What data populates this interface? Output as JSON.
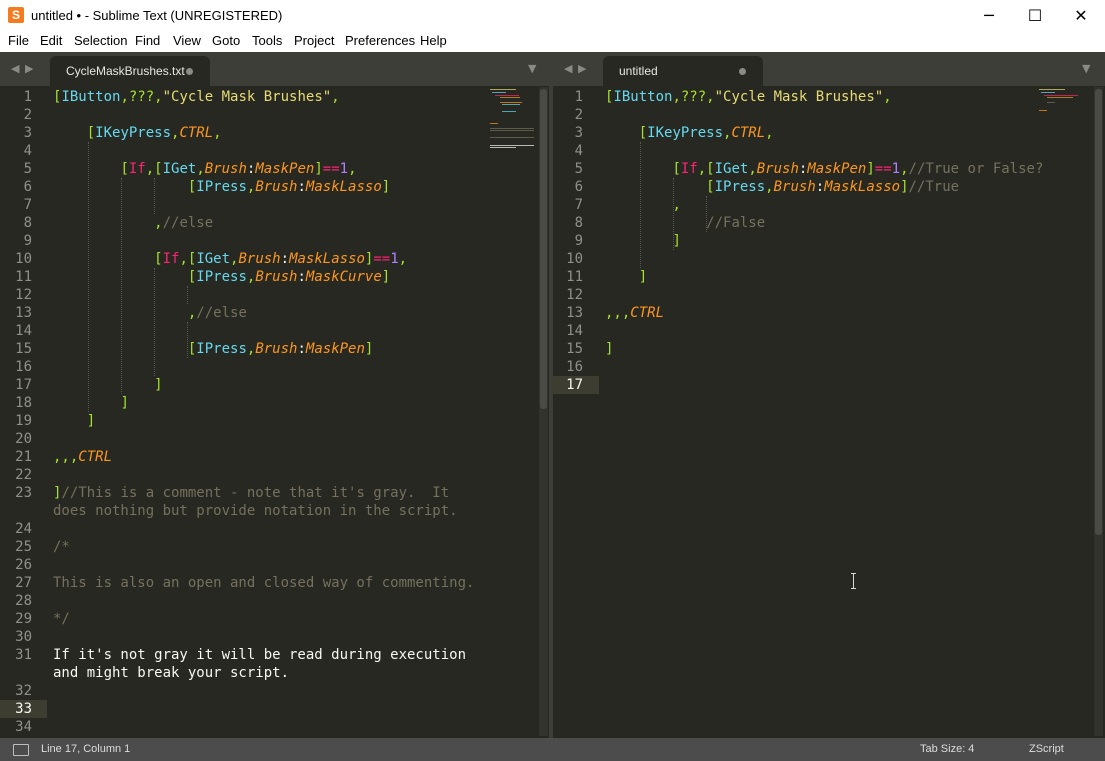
{
  "window": {
    "title": "untitled • - Sublime Text (UNREGISTERED)",
    "minimize_glyph": "─",
    "maximize_glyph": "☐",
    "close_glyph": "✕",
    "app_icon_glyph": "S"
  },
  "menu": [
    "File",
    "Edit",
    "Selection",
    "Find",
    "View",
    "Goto",
    "Tools",
    "Project",
    "Preferences",
    "Help"
  ],
  "colors": {
    "bracket": "#a6e22e",
    "command": "#66d9ef",
    "keyword": "#f92672",
    "param": "#fd971f",
    "string": "#e6db74",
    "number": "#ae81ff",
    "comment": "#75715e",
    "plain": "#f8f8f2"
  },
  "left_pane": {
    "tab_label": "CycleMaskBrushes.txt",
    "current_line": 33,
    "lines": [
      {
        "n": "1",
        "tokens": [
          [
            "[",
            "bracket"
          ],
          [
            "IButton",
            "command"
          ],
          [
            ",???,",
            "bracket"
          ],
          [
            "\"Cycle Mask Brushes\"",
            "string"
          ],
          [
            ",",
            "bracket"
          ]
        ]
      },
      {
        "n": "2",
        "tokens": []
      },
      {
        "n": "3",
        "tokens": [
          [
            "    ",
            ""
          ],
          [
            "[",
            "bracket"
          ],
          [
            "IKeyPress",
            "command"
          ],
          [
            ",",
            "bracket"
          ],
          [
            "CTRL",
            "param"
          ],
          [
            ",",
            "bracket"
          ]
        ]
      },
      {
        "n": "4",
        "tokens": []
      },
      {
        "n": "5",
        "tokens": [
          [
            "        ",
            ""
          ],
          [
            "[",
            "bracket"
          ],
          [
            "If",
            "keyword"
          ],
          [
            ",[",
            "bracket"
          ],
          [
            "IGet",
            "command"
          ],
          [
            ",",
            "bracket"
          ],
          [
            "Brush",
            "param"
          ],
          [
            ":",
            "plain"
          ],
          [
            "MaskPen",
            "param"
          ],
          [
            "]",
            "bracket"
          ],
          [
            "==",
            "keyword"
          ],
          [
            "1",
            "number"
          ],
          [
            ",",
            "bracket"
          ]
        ]
      },
      {
        "n": "6",
        "tokens": [
          [
            "                ",
            ""
          ],
          [
            "[",
            "bracket"
          ],
          [
            "IPress",
            "command"
          ],
          [
            ",",
            "bracket"
          ],
          [
            "Brush",
            "param"
          ],
          [
            ":",
            "plain"
          ],
          [
            "MaskLasso",
            "param"
          ],
          [
            "]",
            "bracket"
          ]
        ]
      },
      {
        "n": "7",
        "tokens": []
      },
      {
        "n": "8",
        "tokens": [
          [
            "            ",
            ""
          ],
          [
            ",",
            "bracket"
          ],
          [
            "//else",
            "comment"
          ]
        ]
      },
      {
        "n": "9",
        "tokens": []
      },
      {
        "n": "10",
        "tokens": [
          [
            "            ",
            ""
          ],
          [
            "[",
            "bracket"
          ],
          [
            "If",
            "keyword"
          ],
          [
            ",[",
            "bracket"
          ],
          [
            "IGet",
            "command"
          ],
          [
            ",",
            "bracket"
          ],
          [
            "Brush",
            "param"
          ],
          [
            ":",
            "plain"
          ],
          [
            "MaskLasso",
            "param"
          ],
          [
            "]",
            "bracket"
          ],
          [
            "==",
            "keyword"
          ],
          [
            "1",
            "number"
          ],
          [
            ",",
            "bracket"
          ]
        ]
      },
      {
        "n": "11",
        "tokens": [
          [
            "                ",
            ""
          ],
          [
            "[",
            "bracket"
          ],
          [
            "IPress",
            "command"
          ],
          [
            ",",
            "bracket"
          ],
          [
            "Brush",
            "param"
          ],
          [
            ":",
            "plain"
          ],
          [
            "MaskCurve",
            "param"
          ],
          [
            "]",
            "bracket"
          ]
        ]
      },
      {
        "n": "12",
        "tokens": []
      },
      {
        "n": "13",
        "tokens": [
          [
            "                ",
            ""
          ],
          [
            ",",
            "bracket"
          ],
          [
            "//else",
            "comment"
          ]
        ]
      },
      {
        "n": "14",
        "tokens": []
      },
      {
        "n": "15",
        "tokens": [
          [
            "                ",
            ""
          ],
          [
            "[",
            "bracket"
          ],
          [
            "IPress",
            "command"
          ],
          [
            ",",
            "bracket"
          ],
          [
            "Brush",
            "param"
          ],
          [
            ":",
            "plain"
          ],
          [
            "MaskPen",
            "param"
          ],
          [
            "]",
            "bracket"
          ]
        ]
      },
      {
        "n": "16",
        "tokens": []
      },
      {
        "n": "17",
        "tokens": [
          [
            "            ",
            ""
          ],
          [
            "]",
            "bracket"
          ]
        ]
      },
      {
        "n": "18",
        "tokens": [
          [
            "        ",
            ""
          ],
          [
            "]",
            "bracket"
          ]
        ]
      },
      {
        "n": "19",
        "tokens": [
          [
            "    ",
            ""
          ],
          [
            "]",
            "bracket"
          ]
        ]
      },
      {
        "n": "20",
        "tokens": []
      },
      {
        "n": "21",
        "tokens": [
          [
            ",,,",
            "bracket"
          ],
          [
            "CTRL",
            "param"
          ]
        ]
      },
      {
        "n": "22",
        "tokens": []
      },
      {
        "n": "23",
        "tokens": [
          [
            "]",
            "bracket"
          ],
          [
            "//This is a comment - note that it's gray.  It",
            "comment"
          ]
        ]
      },
      {
        "n": "",
        "tokens": [
          [
            "does nothing but provide notation in the script.",
            "comment"
          ]
        ]
      },
      {
        "n": "24",
        "tokens": []
      },
      {
        "n": "25",
        "tokens": [
          [
            "/*",
            "comment"
          ]
        ]
      },
      {
        "n": "26",
        "tokens": []
      },
      {
        "n": "27",
        "tokens": [
          [
            "This is also an open and closed way of commenting.",
            "comment"
          ]
        ]
      },
      {
        "n": "28",
        "tokens": []
      },
      {
        "n": "29",
        "tokens": [
          [
            "*/",
            "comment"
          ]
        ]
      },
      {
        "n": "30",
        "tokens": []
      },
      {
        "n": "31",
        "tokens": [
          [
            "If it's not gray it will be read during execution",
            "plain"
          ]
        ]
      },
      {
        "n": "",
        "tokens": [
          [
            "and might break your script.",
            "plain"
          ]
        ]
      },
      {
        "n": "32",
        "tokens": []
      },
      {
        "n": "33",
        "tokens": []
      },
      {
        "n": "34",
        "tokens": []
      }
    ]
  },
  "right_pane": {
    "tab_label": "untitled",
    "current_line": 17,
    "lines": [
      {
        "n": "1",
        "tokens": [
          [
            "[",
            "bracket"
          ],
          [
            "IButton",
            "command"
          ],
          [
            ",???,",
            "bracket"
          ],
          [
            "\"Cycle Mask Brushes\"",
            "string"
          ],
          [
            ",",
            "bracket"
          ]
        ]
      },
      {
        "n": "2",
        "tokens": []
      },
      {
        "n": "3",
        "tokens": [
          [
            "    ",
            ""
          ],
          [
            "[",
            "bracket"
          ],
          [
            "IKeyPress",
            "command"
          ],
          [
            ",",
            "bracket"
          ],
          [
            "CTRL",
            "param"
          ],
          [
            ",",
            "bracket"
          ]
        ]
      },
      {
        "n": "4",
        "tokens": []
      },
      {
        "n": "5",
        "tokens": [
          [
            "        ",
            ""
          ],
          [
            "[",
            "bracket"
          ],
          [
            "If",
            "keyword"
          ],
          [
            ",[",
            "bracket"
          ],
          [
            "IGet",
            "command"
          ],
          [
            ",",
            "bracket"
          ],
          [
            "Brush",
            "param"
          ],
          [
            ":",
            "plain"
          ],
          [
            "MaskPen",
            "param"
          ],
          [
            "]",
            "bracket"
          ],
          [
            "==",
            "keyword"
          ],
          [
            "1",
            "number"
          ],
          [
            ",",
            "bracket"
          ],
          [
            "//True or False?",
            "comment"
          ]
        ]
      },
      {
        "n": "6",
        "tokens": [
          [
            "            ",
            ""
          ],
          [
            "[",
            "bracket"
          ],
          [
            "IPress",
            "command"
          ],
          [
            ",",
            "bracket"
          ],
          [
            "Brush",
            "param"
          ],
          [
            ":",
            "plain"
          ],
          [
            "MaskLasso",
            "param"
          ],
          [
            "]",
            "bracket"
          ],
          [
            "//True",
            "comment"
          ]
        ]
      },
      {
        "n": "7",
        "tokens": [
          [
            "        ",
            ""
          ],
          [
            ",",
            "bracket"
          ]
        ]
      },
      {
        "n": "8",
        "tokens": [
          [
            "            ",
            ""
          ],
          [
            "//False",
            "comment"
          ]
        ]
      },
      {
        "n": "9",
        "tokens": [
          [
            "        ",
            ""
          ],
          [
            "]",
            "bracket"
          ]
        ]
      },
      {
        "n": "10",
        "tokens": []
      },
      {
        "n": "11",
        "tokens": [
          [
            "    ",
            ""
          ],
          [
            "]",
            "bracket"
          ]
        ]
      },
      {
        "n": "12",
        "tokens": []
      },
      {
        "n": "13",
        "tokens": [
          [
            ",,,",
            "bracket"
          ],
          [
            "CTRL",
            "param"
          ]
        ]
      },
      {
        "n": "14",
        "tokens": []
      },
      {
        "n": "15",
        "tokens": [
          [
            "]",
            "bracket"
          ]
        ]
      },
      {
        "n": "16",
        "tokens": []
      },
      {
        "n": "17",
        "tokens": []
      }
    ]
  },
  "status": {
    "position": "Line 17, Column 1",
    "tab_size": "Tab Size: 4",
    "syntax": "ZScript"
  }
}
